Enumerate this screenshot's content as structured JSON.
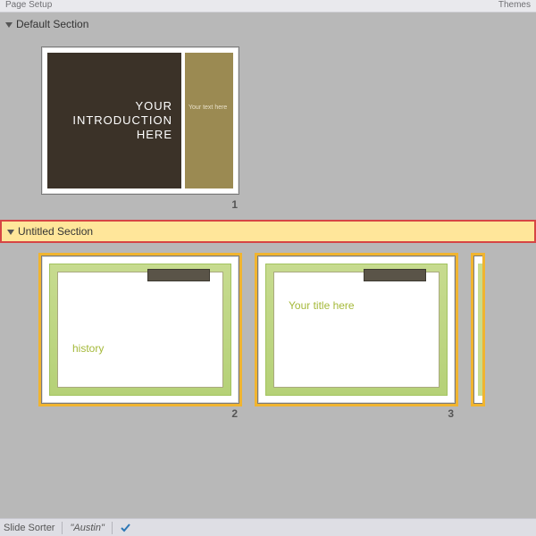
{
  "ribbon": {
    "left_group": "Page Setup",
    "right_group": "Themes"
  },
  "sections": [
    {
      "name": "Default Section",
      "selected": false,
      "slides": [
        {
          "number": "1",
          "title": "YOUR INTRODUCTION HERE",
          "subtitle": "Your text here",
          "selected": false
        }
      ]
    },
    {
      "name": "Untitled Section",
      "selected": true,
      "slides": [
        {
          "number": "2",
          "text": "history",
          "selected": true
        },
        {
          "number": "3",
          "text": "Your title here",
          "selected": true
        }
      ]
    }
  ],
  "status": {
    "view": "Slide Sorter",
    "theme": "\"Austin\""
  },
  "colors": {
    "section_highlight_bg": "#ffe69a",
    "section_highlight_border": "#d64545",
    "slide_selected_outline": "#f0b430",
    "slide1_dark": "#3b3228",
    "slide1_accent": "#9b8a52",
    "green_theme_bg": "#c7db8f",
    "green_theme_text": "#a5b93a",
    "green_tab": "#5a5448"
  }
}
